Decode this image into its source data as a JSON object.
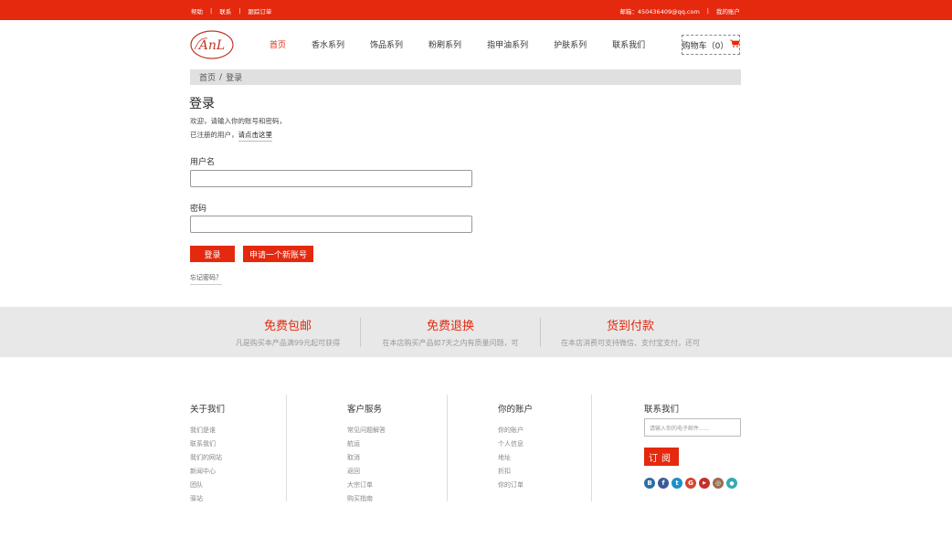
{
  "topbar": {
    "help": "帮助",
    "contact": "联系",
    "track": "跟踪订单",
    "sep": "|",
    "email": "邮箱：450436409@qq.com",
    "my_account": "我的账户"
  },
  "header": {
    "logo_text": "AnL",
    "nav": [
      "首页",
      "香水系列",
      "饰品系列",
      "粉刷系列",
      "指甲油系列",
      "护肤系列",
      "联系我们"
    ],
    "cart_label": "购物车（0）"
  },
  "breadcrumb": {
    "home": "首页",
    "sep": "/",
    "current": "登录"
  },
  "login": {
    "title": "登录",
    "welcome": "欢迎，请输入你的账号和密码，",
    "registered_prefix": "已注册的用户，",
    "registered_link": "请点击这里",
    "username_label": "用户名",
    "password_label": "密码",
    "login_button": "登录",
    "register_button": "申请一个新账号",
    "forgot": "忘记密码？"
  },
  "features": [
    {
      "title": "免费包邮",
      "desc": "凡是购买本产品满99元起可获得"
    },
    {
      "title": "免费退换",
      "desc": "在本店购买产品如7天之内有质量问题，可"
    },
    {
      "title": "货到付款",
      "desc": "在本店消费可支持微信、支付宝支付，还可"
    }
  ],
  "footer": {
    "about": {
      "title": "关于我们",
      "links": [
        "我们是谁",
        "联系我们",
        "我们的网站",
        "新闻中心",
        "团队",
        "驿站"
      ]
    },
    "service": {
      "title": "客户服务",
      "links": [
        "常见问题解答",
        "航运",
        "取消",
        "返回",
        "大宗订单",
        "购买指南"
      ]
    },
    "account": {
      "title": "你的账户",
      "links": [
        "你的账户",
        "个人信息",
        "地址",
        "折扣",
        "你的订单"
      ]
    },
    "contact": {
      "title": "联系我们",
      "email_placeholder": "请输入你的电子邮件......",
      "subscribe": "订阅"
    },
    "socials": [
      {
        "icon": "blog-icon",
        "glyph": "B",
        "color": "#2c6fa3"
      },
      {
        "icon": "facebook-icon",
        "glyph": "f",
        "color": "#3b5998"
      },
      {
        "icon": "twitter-icon",
        "glyph": "t",
        "color": "#1d8fc7"
      },
      {
        "icon": "google-plus-icon",
        "glyph": "G",
        "color": "#d64532"
      },
      {
        "icon": "youtube-icon",
        "glyph": "▶",
        "color": "#c4302b"
      },
      {
        "icon": "instagram-icon",
        "glyph": "◎",
        "color": "#9b6b4c"
      },
      {
        "icon": "map-pin-icon",
        "glyph": "●",
        "color": "#35a9b5"
      }
    ]
  },
  "colors": {
    "brand_red": "#e4290e",
    "band_grey": "#e8e8e8"
  }
}
